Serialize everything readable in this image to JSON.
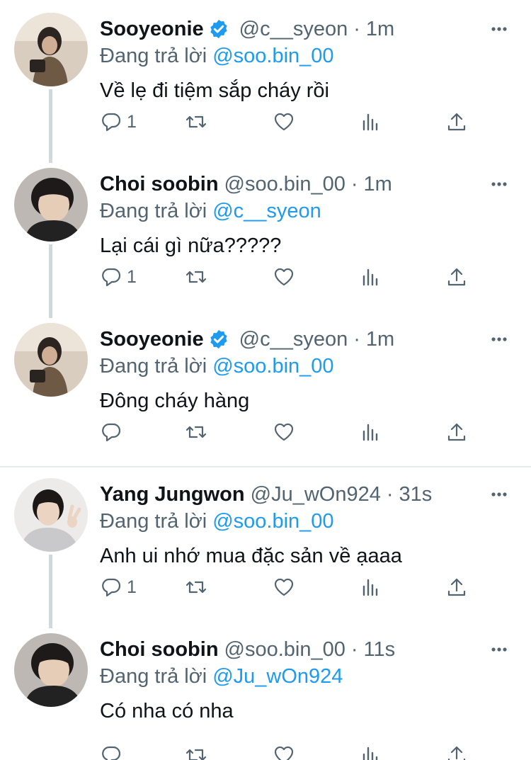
{
  "reply_prefix": "Đang trả lời",
  "colors": {
    "accent": "#1d9bf0",
    "secondary_text": "#536471",
    "thread_line": "#cfd9de"
  },
  "tweets": [
    {
      "display_name": "Sooyeonie",
      "verified": true,
      "handle": "@c__syeon",
      "dot": "·",
      "time": "1m",
      "reply_to": "@soo.bin_00",
      "text": "Về lẹ đi tiệm sắp cháy rồi",
      "reply_count": "1",
      "avatar": "sooyeonie-avatar"
    },
    {
      "display_name": "Choi soobin",
      "verified": false,
      "handle": "@soo.bin_00",
      "dot": "·",
      "time": "1m",
      "reply_to": "@c__syeon",
      "text": "Lại cái gì nữa?????",
      "reply_count": "1",
      "avatar": "choi-soobin-avatar"
    },
    {
      "display_name": "Sooyeonie",
      "verified": true,
      "handle": "@c__syeon",
      "dot": "·",
      "time": "1m",
      "reply_to": "@soo.bin_00",
      "text": "Đông cháy hàng",
      "reply_count": "",
      "avatar": "sooyeonie-avatar"
    },
    {
      "display_name": "Yang Jungwon",
      "verified": false,
      "handle": "@Ju_wOn924",
      "dot": "·",
      "time": "31s",
      "reply_to": "@soo.bin_00",
      "text": "Anh ui nhớ mua đặc sản về ạaaa",
      "reply_count": "1",
      "avatar": "yang-jungwon-avatar"
    },
    {
      "display_name": "Choi soobin",
      "verified": false,
      "handle": "@soo.bin_00",
      "dot": "·",
      "time": "11s",
      "reply_to": "@Ju_wOn924",
      "text": "Có nha có nha",
      "reply_count": "",
      "avatar": "choi-soobin-avatar"
    }
  ]
}
